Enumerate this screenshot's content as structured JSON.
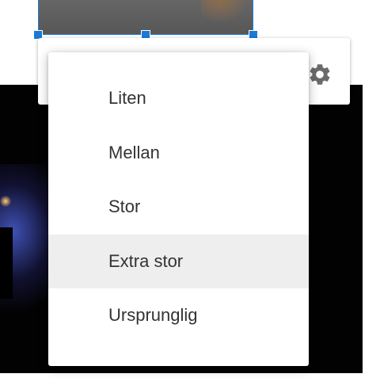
{
  "size_menu": {
    "items": [
      {
        "label": "Liten"
      },
      {
        "label": "Mellan"
      },
      {
        "label": "Stor"
      },
      {
        "label": "Extra stor"
      },
      {
        "label": "Ursprunglig"
      }
    ],
    "highlighted_index": 3
  },
  "toolbar": {
    "settings_icon": "gear-icon"
  },
  "colors": {
    "selection": "#1a7bd6",
    "menu_hover": "#eeeeee",
    "text": "#333333",
    "icon": "#6b6b6b"
  }
}
